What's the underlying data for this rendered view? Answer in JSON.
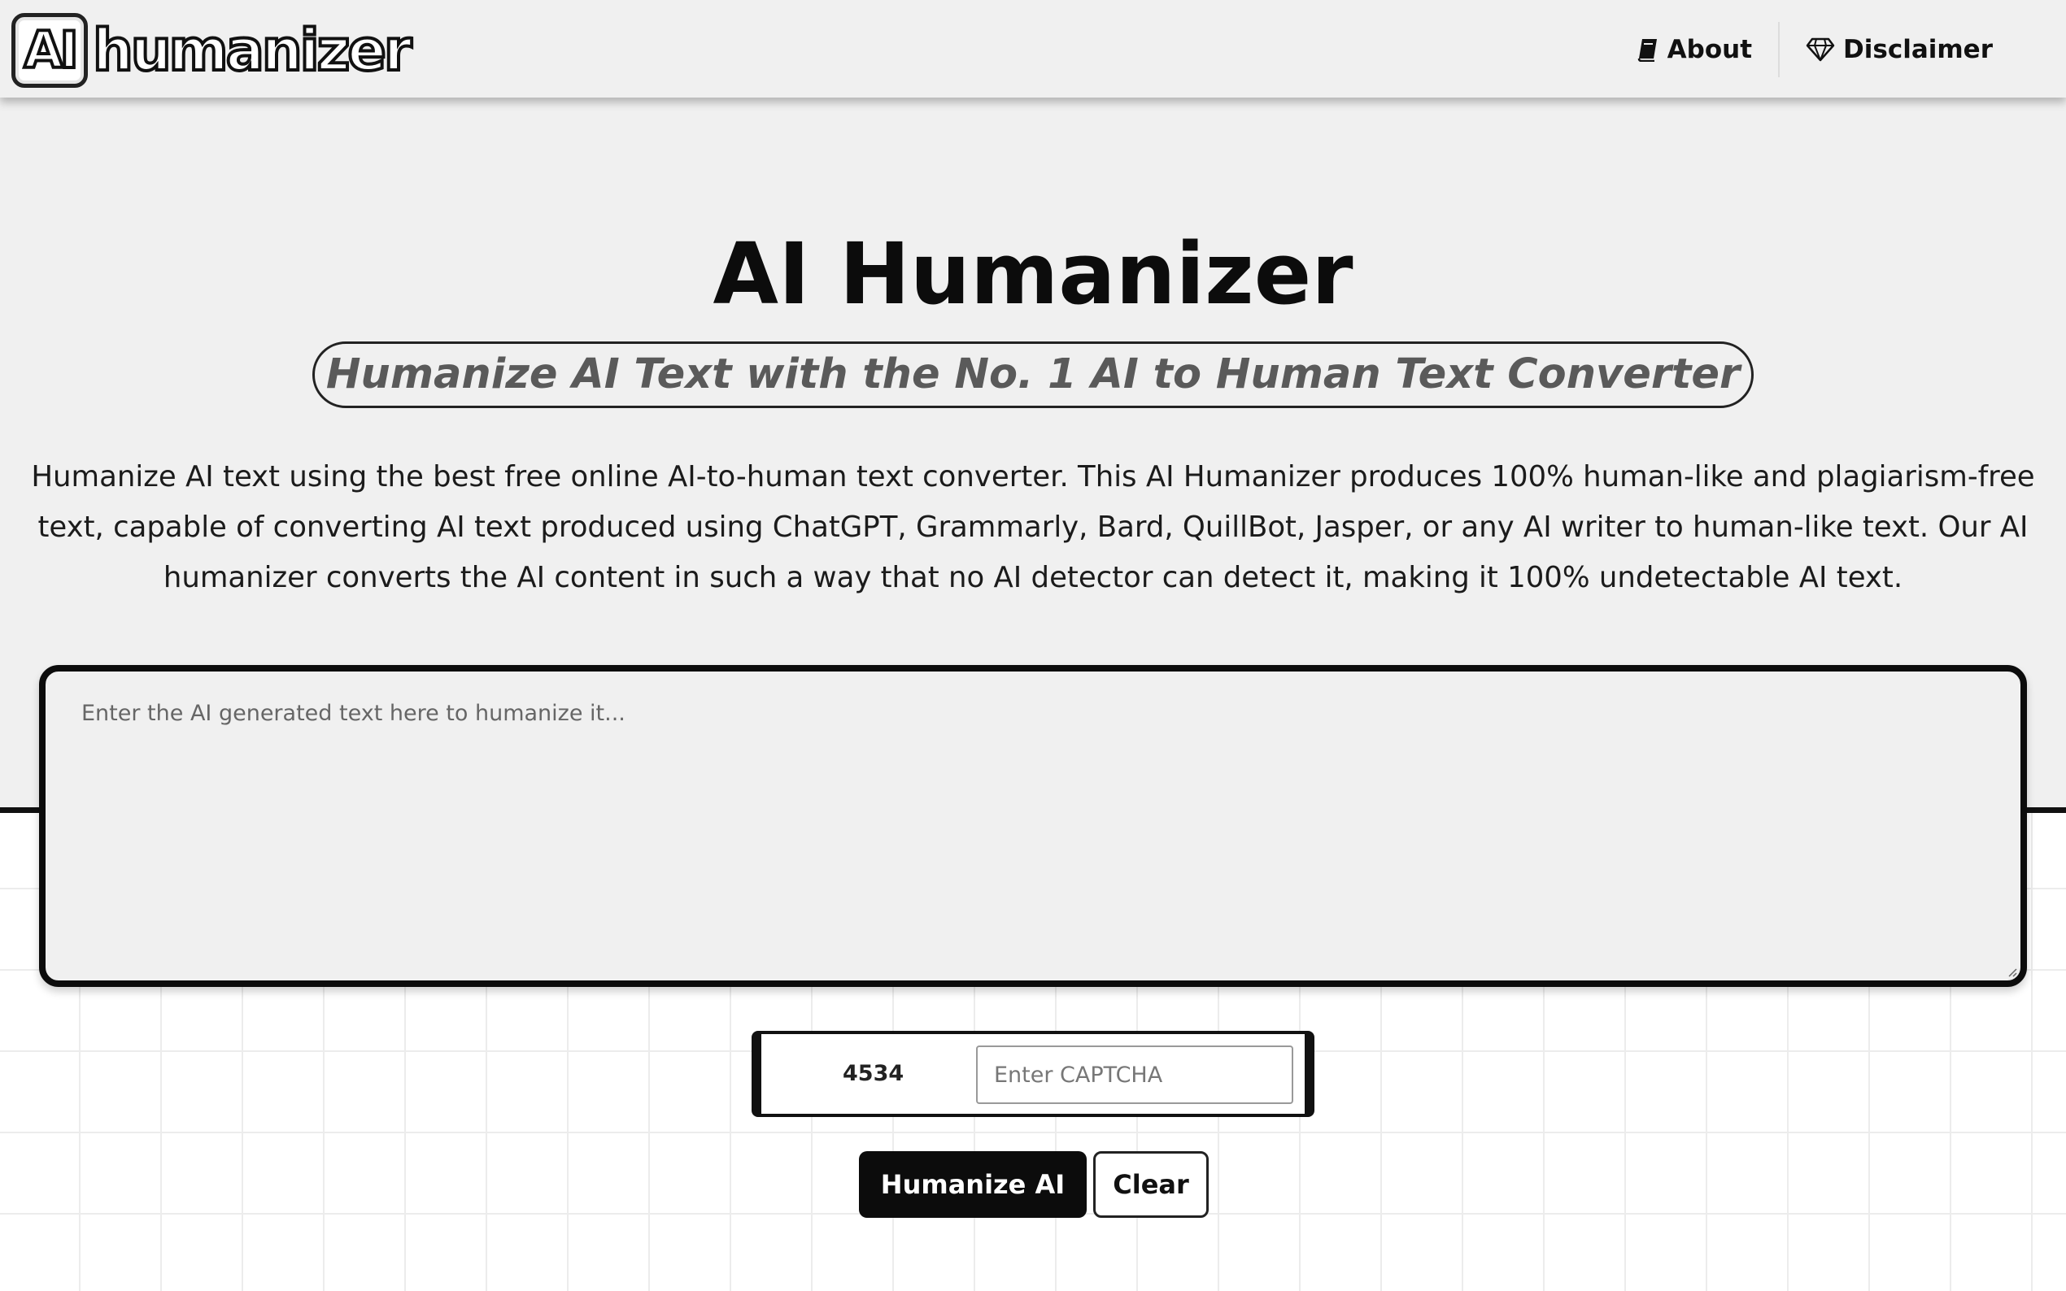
{
  "header": {
    "logo_mark": "AI",
    "logo_word": "humanizer",
    "nav": [
      {
        "label": "About",
        "icon": "book-icon"
      },
      {
        "label": "Disclaimer",
        "icon": "diamond-icon"
      }
    ]
  },
  "hero": {
    "title": "AI Humanizer",
    "subtitle": "Humanize AI Text with the No. 1 AI to Human Text Converter",
    "description": "Humanize AI text using the best free online AI-to-human text converter. This AI Humanizer produces 100% human-like and plagiarism-free text, capable of converting AI text produced using ChatGPT, Grammarly, Bard, QuillBot, Jasper, or any AI writer to human-like text. Our AI humanizer converts the AI content in such a way that no AI detector can detect it, making it 100% undetectable AI text."
  },
  "editor": {
    "value": "",
    "placeholder": "Enter the AI generated text here to humanize it..."
  },
  "captcha": {
    "code": "4534",
    "value": "",
    "placeholder": "Enter CAPTCHA"
  },
  "actions": {
    "humanize_label": "Humanize AI",
    "clear_label": "Clear"
  },
  "colors": {
    "hero_bg": "#f0f0f0",
    "primary": "#0c0c0c",
    "accent_text": "#5a5a5a"
  }
}
